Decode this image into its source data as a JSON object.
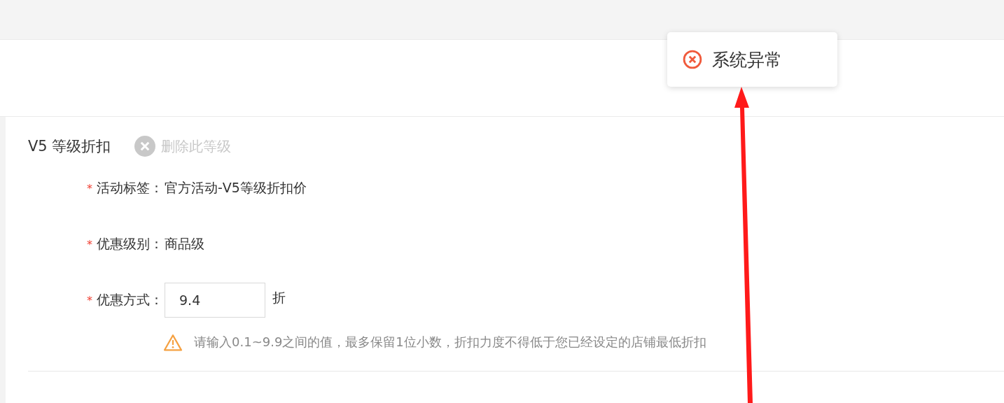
{
  "toast": {
    "message": "系统异常"
  },
  "section": {
    "title": "V5 等级折扣",
    "delete_action": {
      "label": "删除此等级",
      "disabled": true
    }
  },
  "fields": [
    {
      "kind": "text",
      "required_mark": "*",
      "label": "活动标签：",
      "value": "官方活动-V5等级折扣价"
    },
    {
      "kind": "text",
      "required_mark": "*",
      "label": "优惠级别：",
      "value": "商品级"
    },
    {
      "kind": "input",
      "required_mark": "*",
      "label": "优惠方式：",
      "value": "9.4",
      "unit": "折"
    }
  ],
  "hint": {
    "text": "请输入0.1~9.9之间的值，最多保留1位小数，折扣力度不得低于您已经设定的店铺最低折扣"
  }
}
